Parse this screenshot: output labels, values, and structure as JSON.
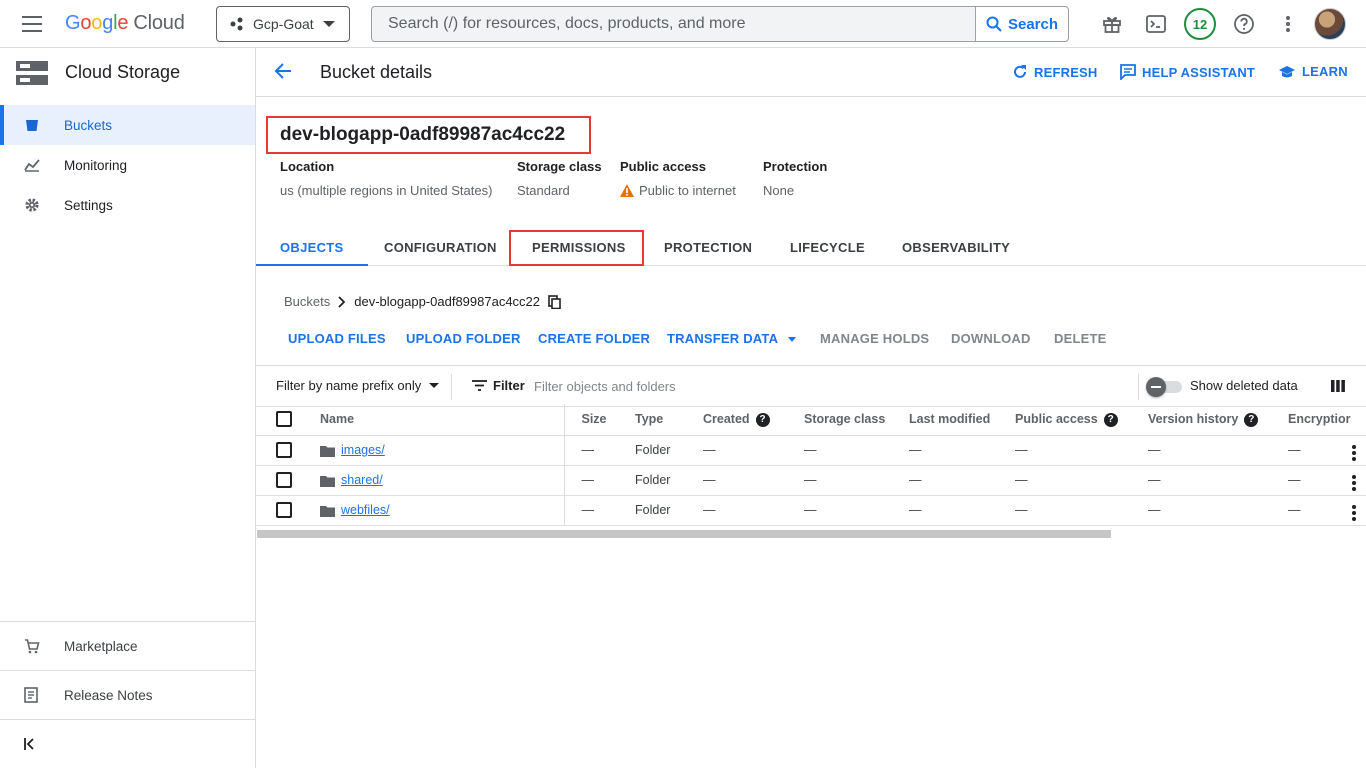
{
  "topbar": {
    "logo_google": "Google",
    "logo_cloud": "Cloud",
    "project": "Gcp-Goat",
    "search_placeholder": "Search (/) for resources, docs, products, and more",
    "search_button": "Search",
    "notification_count": "12"
  },
  "sidebar": {
    "product": "Cloud Storage",
    "items": [
      {
        "label": "Buckets",
        "icon": "bucket-icon",
        "active": true
      },
      {
        "label": "Monitoring",
        "icon": "monitoring-icon"
      },
      {
        "label": "Settings",
        "icon": "gear-icon"
      }
    ],
    "marketplace": "Marketplace",
    "release_notes": "Release Notes"
  },
  "header": {
    "title": "Bucket details",
    "refresh": "REFRESH",
    "help_assistant": "HELP ASSISTANT",
    "learn": "LEARN"
  },
  "bucket": {
    "name": "dev-blogapp-0adf89987ac4cc22",
    "location_label": "Location",
    "location": "us (multiple regions in United States)",
    "storage_class_label": "Storage class",
    "storage_class": "Standard",
    "public_access_label": "Public access",
    "public_access": "Public to internet",
    "protection_label": "Protection",
    "protection": "None"
  },
  "tabs": [
    "OBJECTS",
    "CONFIGURATION",
    "PERMISSIONS",
    "PROTECTION",
    "LIFECYCLE",
    "OBSERVABILITY"
  ],
  "breadcrumb": {
    "root": "Buckets",
    "current": "dev-blogapp-0adf89987ac4cc22"
  },
  "actions": {
    "upload_files": "UPLOAD FILES",
    "upload_folder": "UPLOAD FOLDER",
    "create_folder": "CREATE FOLDER",
    "transfer_data": "TRANSFER DATA",
    "manage_holds": "MANAGE HOLDS",
    "download": "DOWNLOAD",
    "delete": "DELETE"
  },
  "filterbar": {
    "prefix": "Filter by name prefix only",
    "filter": "Filter",
    "placeholder": "Filter objects and folders",
    "show_deleted": "Show deleted data"
  },
  "table": {
    "columns": [
      "Name",
      "Size",
      "Type",
      "Created",
      "Storage class",
      "Last modified",
      "Public access",
      "Version history",
      "Encryptior"
    ],
    "rows": [
      {
        "name": "images/",
        "size": "—",
        "type": "Folder",
        "created": "—",
        "storage_class": "—",
        "last_modified": "—",
        "public_access": "—",
        "version_history": "—",
        "encryption": "—"
      },
      {
        "name": "shared/",
        "size": "—",
        "type": "Folder",
        "created": "—",
        "storage_class": "—",
        "last_modified": "—",
        "public_access": "—",
        "version_history": "—",
        "encryption": "—"
      },
      {
        "name": "webfiles/",
        "size": "—",
        "type": "Folder",
        "created": "—",
        "storage_class": "—",
        "last_modified": "—",
        "public_access": "—",
        "version_history": "—",
        "encryption": "—"
      }
    ]
  },
  "colors": {
    "accent": "#1a73e8",
    "highlight": "#e53935",
    "warning": "#e37400"
  }
}
